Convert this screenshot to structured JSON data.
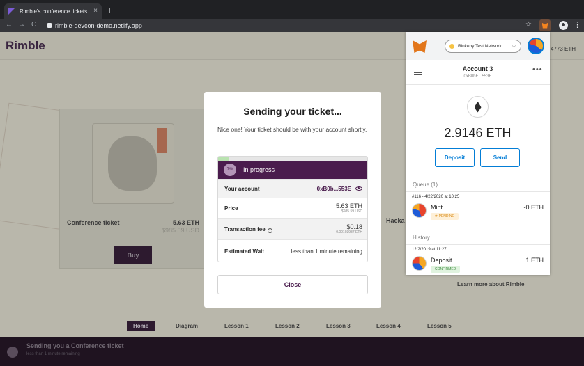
{
  "browser": {
    "tab_title": "Rimble's conference tickets",
    "tab_close": "×",
    "new_tab": "+",
    "back": "←",
    "forward": "→",
    "reload": "C",
    "url": "rimble-devcon-demo.netlify.app",
    "bookmark": "☆",
    "menu": "⋮"
  },
  "page": {
    "logo": "Rimble",
    "header_eth": "4773 ETH",
    "card": {
      "title": "Conference ticket",
      "price": "5.63 ETH",
      "usd": "$985.59 USD",
      "buy_label": "Buy"
    },
    "hack_label": "Hacka",
    "learn_more": "Learn more about Rimble",
    "nav": [
      "Home",
      "Diagram",
      "Lesson 1",
      "Lesson 2",
      "Lesson 3",
      "Lesson 4",
      "Lesson 5"
    ],
    "footer": {
      "title": "Sending you a Conference ticket",
      "subtitle": "less than 1 minute remaining"
    }
  },
  "modal": {
    "title": "Sending your ticket...",
    "body": "Nice one! Your ticket should be with your account shortly.",
    "progress_percent": 7,
    "progress_label": "7%",
    "status": "In progress",
    "rows": {
      "account_label": "Your account",
      "account_value": "0xB0b...553E",
      "price_label": "Price",
      "price_value": "5.63 ETH",
      "price_usd": "$985.59 USD",
      "fee_label": "Transaction fee",
      "fee_value": "$0.18",
      "fee_eth": "0.00103987 ETH",
      "wait_label": "Estimated Wait",
      "wait_value": "less than 1 minute remaining"
    },
    "close_label": "Close"
  },
  "metamask": {
    "network": "Rinkeby Test Network",
    "account_name": "Account 3",
    "account_address": "0xB0bE...553E",
    "balance": "2.9146 ETH",
    "deposit_label": "Deposit",
    "send_label": "Send",
    "queue_label": "Queue (1)",
    "history_label": "History",
    "queue_item": {
      "date": "#116 - 4/22/2020 at 10:25",
      "name": "Mint",
      "amount": "-0 ETH",
      "status": "PENDING"
    },
    "history_item": {
      "date": "12/2/2019 at 11:27",
      "name": "Deposit",
      "amount": "1 ETH",
      "status": "CONFIRMED"
    }
  }
}
